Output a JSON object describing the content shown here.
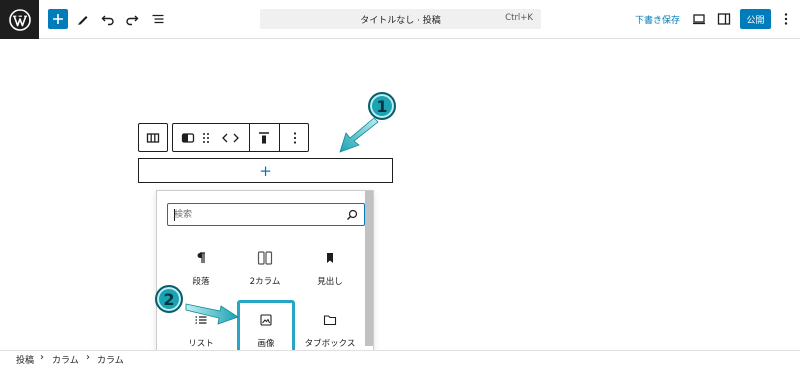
{
  "toolbar": {
    "doc_title": "タイトルなし · 投稿",
    "shortcut": "Ctrl+K",
    "save_draft_label": "下書き保存",
    "publish_label": "公開"
  },
  "inserter": {
    "search_placeholder": "検索",
    "blocks": [
      {
        "label": "段落",
        "icon": "paragraph-icon"
      },
      {
        "label": "2カラム",
        "icon": "columns-icon"
      },
      {
        "label": "見出し",
        "icon": "heading-icon"
      },
      {
        "label": "リスト",
        "icon": "list-icon"
      },
      {
        "label": "画像",
        "icon": "image-icon"
      },
      {
        "label": "タブボックス",
        "icon": "folder-icon"
      }
    ]
  },
  "appender": {
    "label": "+"
  },
  "annotations": {
    "step1": "1",
    "step2": "2"
  },
  "breadcrumb": [
    "投稿",
    "カラム",
    "カラム"
  ],
  "colors": {
    "accent": "#007cba",
    "highlight": "#26a6c4",
    "badge": "#1aa3b3"
  }
}
